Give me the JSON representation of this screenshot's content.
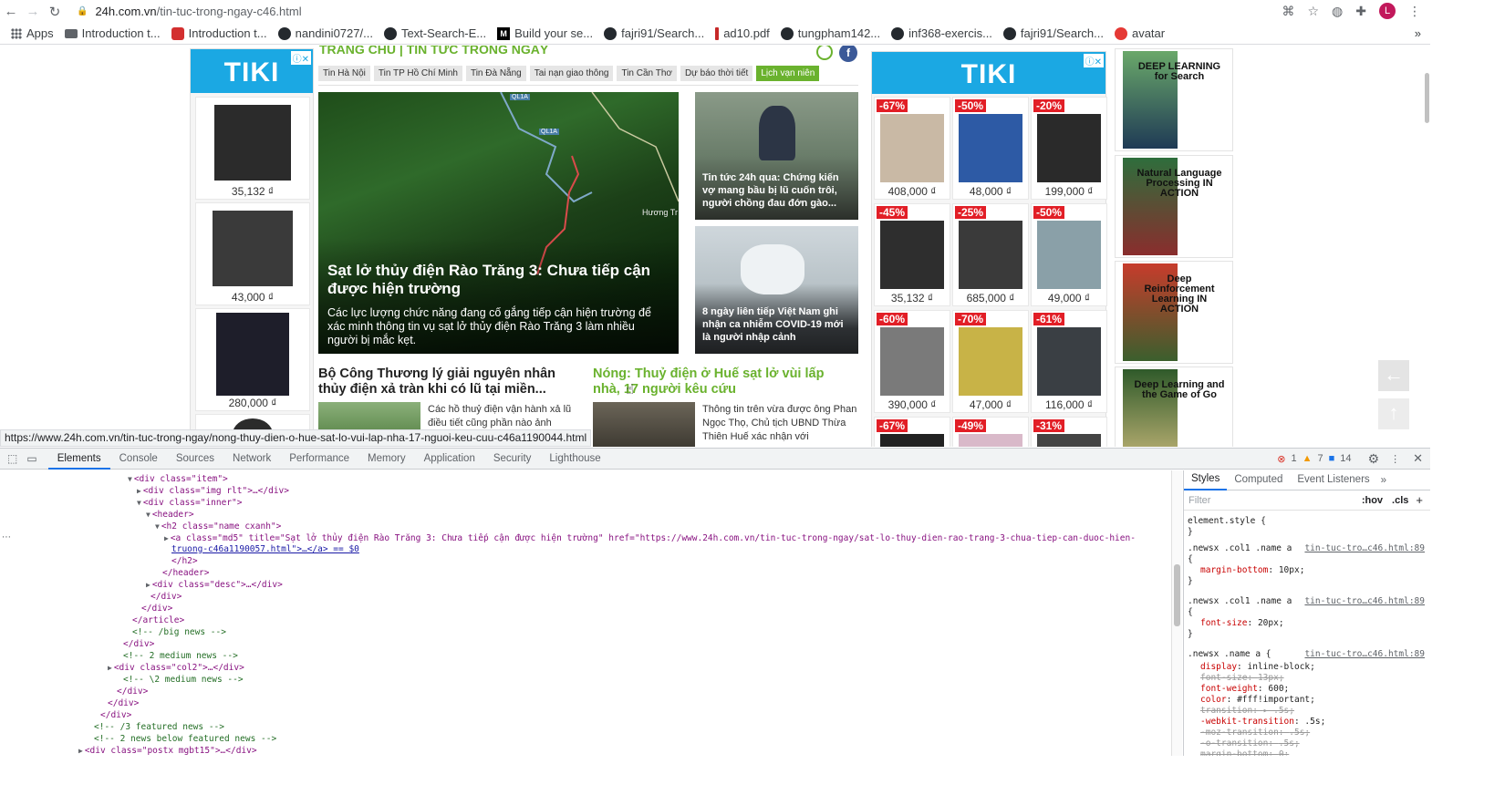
{
  "browser": {
    "url_host": "24h.com.vn",
    "url_path": "/tin-tuc-trong-ngay-c46.html",
    "avatar_letter": "L",
    "bookmarks": [
      {
        "label": "Apps",
        "icon": "grid-icon"
      },
      {
        "label": "Introduction t...",
        "icon": "folder-icon"
      },
      {
        "label": "Introduction t...",
        "icon": "site-icon"
      },
      {
        "label": "nandini0727/...",
        "icon": "github-icon"
      },
      {
        "label": "Text-Search-E...",
        "icon": "github-icon"
      },
      {
        "label": "Build your se...",
        "icon": "medium-icon"
      },
      {
        "label": "fajri91/Search...",
        "icon": "github-icon"
      },
      {
        "label": "ad10.pdf",
        "icon": "pdf-icon"
      },
      {
        "label": "tungpham142...",
        "icon": "github-icon"
      },
      {
        "label": "inf368-exercis...",
        "icon": "github-icon"
      },
      {
        "label": "fajri91/Search...",
        "icon": "github-icon"
      },
      {
        "label": "avatar",
        "icon": "avatar-icon"
      }
    ]
  },
  "site": {
    "breadcrumb": "TRANG CHỦ | TIN TỨC TRONG NGÀY",
    "tabs": [
      "Tin Hà Nội",
      "Tin TP Hồ Chí Minh",
      "Tin Đà Nẵng",
      "Tai nạn giao thông",
      "Tin Cần Thơ",
      "Dự báo thời tiết",
      "Lịch vạn niên"
    ],
    "big_news": {
      "title": "Sạt lở thủy điện Rào Trăng 3: Chưa tiếp cận được hiện trường",
      "desc": "Các lực lượng chức năng đang cố gắng tiếp cận hiện trường để xác minh thông tin vụ sạt lở thủy điện Rào Trăng 3 làm nhiều người bị mắc kẹt.",
      "map_labels": [
        "QL1A",
        "QL1A",
        "Hương Tr"
      ]
    },
    "side_news": [
      {
        "title": "Tin tức 24h qua: Chứng kiến vợ mang bầu bị lũ cuốn trôi, người chồng đau đớn gào..."
      },
      {
        "title": "8 ngày liên tiếp Việt Nam ghi nhận ca nhiễm COVID-19 mới là người nhập cảnh"
      }
    ],
    "medium_news": [
      {
        "title": "Bộ Công Thương lý giải nguyên nhân thủy điện xả tràn khi có lũ tại miền...",
        "desc": "Các hồ thuỷ điện vận hành xả lũ điều tiết cũng phần nào ảnh"
      },
      {
        "title": "Nóng: Thuỷ điện ở Huế sạt lở vùi lấp nhà, 17 người kêu cứu",
        "desc": "Thông tin trên vừa được ông Phan Ngọc Thọ, Chủ tịch UBND Thừa Thiên Huế xác nhận với"
      }
    ],
    "ad_left": {
      "brand": "TIKI",
      "prices": [
        "35,132 ₫",
        "43,000 ₫",
        "280,000 ₫"
      ]
    },
    "ad_right": {
      "brand": "TIKI",
      "items": [
        {
          "discount": "-67%",
          "price": "408,000 ₫"
        },
        {
          "discount": "-50%",
          "price": "48,000 ₫"
        },
        {
          "discount": "-20%",
          "price": "199,000 ₫"
        },
        {
          "discount": "-45%",
          "price": "35,132 ₫"
        },
        {
          "discount": "-25%",
          "price": "685,000 ₫"
        },
        {
          "discount": "-50%",
          "price": "49,000 ₫"
        },
        {
          "discount": "-60%",
          "price": "390,000 ₫"
        },
        {
          "discount": "-70%",
          "price": "47,000 ₫"
        },
        {
          "discount": "-61%",
          "price": "116,000 ₫"
        },
        {
          "discount": "-67%",
          "price": ""
        },
        {
          "discount": "-49%",
          "price": ""
        },
        {
          "discount": "-31%",
          "price": ""
        }
      ]
    },
    "books": [
      {
        "title": "DEEP LEARNING for Search"
      },
      {
        "title": "Natural Language Processing IN ACTION"
      },
      {
        "title": "Deep Reinforcement Learning IN ACTION"
      },
      {
        "title": "Deep Learning and the Game of Go"
      }
    ]
  },
  "status_url": "https://www.24h.com.vn/tin-tuc-trong-ngay/nong-thuy-dien-o-hue-sat-lo-vui-lap-nha-17-nguoi-keu-cuu-c46a1190044.html",
  "devtools": {
    "tabs": [
      "Elements",
      "Console",
      "Sources",
      "Network",
      "Performance",
      "Memory",
      "Application",
      "Security",
      "Lighthouse"
    ],
    "errors": "1",
    "warnings": "7",
    "messages": "14",
    "dom_lines": [
      "<div class=\"item\">",
      "<div class=\"img rlt\">…</div>",
      "<div class=\"inner\">",
      "<header>",
      "<h2 class=\"name cxanh\">",
      "<a class=\"md5\" title=\"Sạt lở thủy điện Rào Trăng 3: Chưa tiếp cận được hiện trường\" href=\"https://www.24h.com.vn/tin-tuc-trong-ngay/sat-lo-thuy-dien-rao-trang-3-chua-tiep-can-duoc-hien-",
      "truong-c46a1190057.html\">…</a> == $0",
      "</h2>",
      "</header>",
      "<div class=\"desc\">…</div>",
      "</div>",
      "</div>",
      "</article>",
      "<!-- /big news -->",
      "</div>",
      "<!-- 2 medium news -->",
      "<div class=\"col2\">…</div>",
      "<!-- \\2 medium news -->",
      "</div>",
      "</div>",
      "</div>",
      "<!-- /3 featured news -->",
      "<!-- 2 news below featured news -->",
      "<div class=\"postx mgbt15\">…</div>"
    ],
    "styles_tabs": [
      "Styles",
      "Computed",
      "Event Listeners"
    ],
    "filter_placeholder": "Filter",
    "hov": ":hov",
    "cls": ".cls",
    "rules": [
      {
        "selector": "element.style {",
        "source": "",
        "props": []
      },
      {
        "selector": ".newsx .col1 .name a",
        "source": "tin-tuc-tro…c46.html:89",
        "props": [
          [
            "margin-bottom",
            "10px;",
            false
          ]
        ]
      },
      {
        "selector": ".newsx .col1 .name a",
        "source": "tin-tuc-tro…c46.html:89",
        "props": [
          [
            "font-size",
            "20px;",
            false
          ]
        ]
      },
      {
        "selector": ".newsx .name a {",
        "source": "tin-tuc-tro…c46.html:89",
        "props": [
          [
            "display",
            "inline-block;",
            false
          ],
          [
            "font-size",
            "13px;",
            true
          ],
          [
            "font-weight",
            "600;",
            false
          ],
          [
            "color",
            "#fff!important;",
            false
          ],
          [
            "transition",
            "▸ .5s;",
            true
          ],
          [
            "-webkit-transition",
            ".5s;",
            false
          ],
          [
            "-moz-transition",
            ".5s;",
            true
          ],
          [
            "-o-transition",
            ".5s;",
            true
          ],
          [
            "margin-bottom",
            "0;",
            true
          ]
        ]
      }
    ]
  }
}
